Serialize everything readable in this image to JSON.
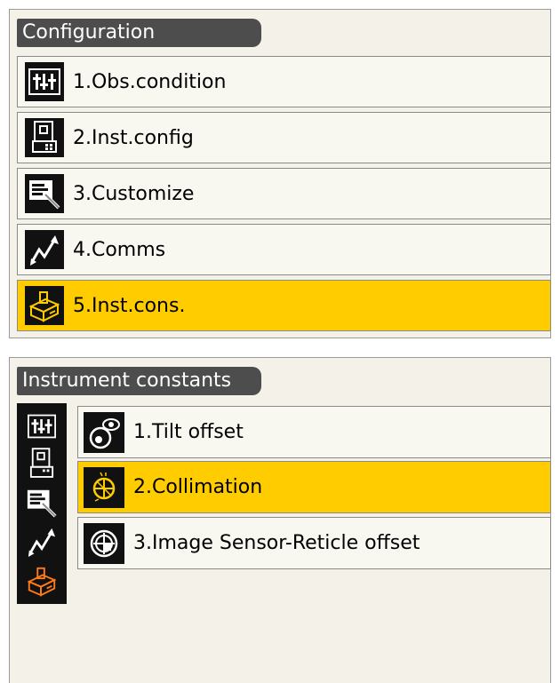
{
  "configuration": {
    "title": "Configuration",
    "items": [
      {
        "label": "1.Obs.condition",
        "icon": "obs-condition-icon"
      },
      {
        "label": "2.Inst.config",
        "icon": "instrument-config-icon"
      },
      {
        "label": "3.Customize",
        "icon": "customize-icon"
      },
      {
        "label": "4.Comms",
        "icon": "comms-icon"
      },
      {
        "label": "5.Inst.cons.",
        "icon": "instrument-constants-icon",
        "selected": true
      }
    ]
  },
  "instrument_constants": {
    "title": "Instrument constants",
    "items": [
      {
        "label": "1.Tilt offset",
        "icon": "tilt-offset-icon"
      },
      {
        "label": "2.Collimation",
        "icon": "collimation-icon",
        "selected": true
      },
      {
        "label": "3.Image Sensor-Reticle offset",
        "icon": "reticle-offset-icon"
      }
    ]
  },
  "colors": {
    "selected": "#ffcc00",
    "title_bg": "#4d4d4d",
    "panel_bg": "#f3f1e8",
    "icon_bg": "#111111",
    "active_sidebar_icon": "#ff7a1a"
  }
}
